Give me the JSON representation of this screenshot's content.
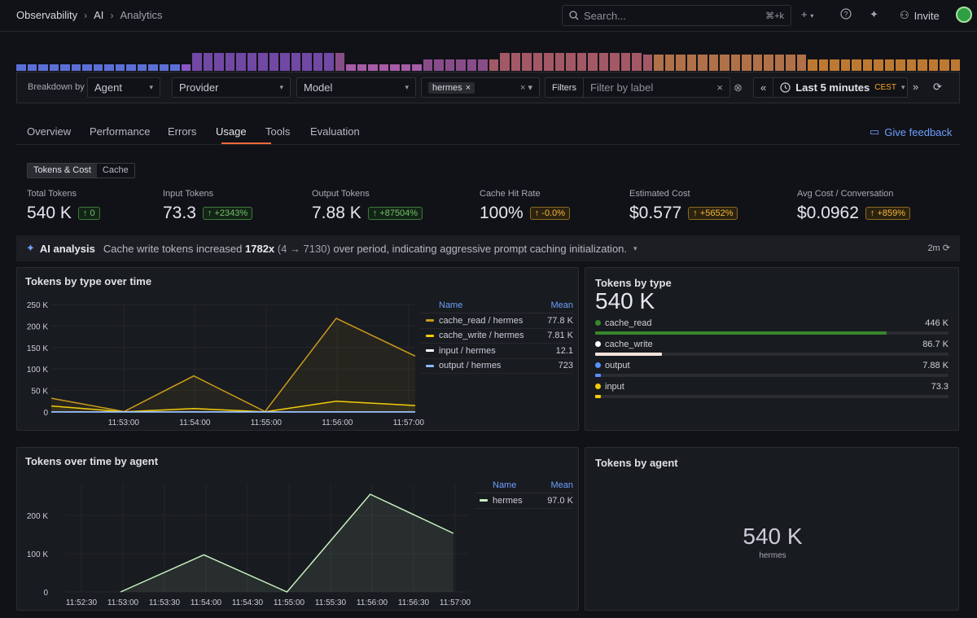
{
  "breadcrumbs": [
    "Observability",
    "AI",
    "Analytics"
  ],
  "search": {
    "placeholder": "Search...",
    "shortcut": "⌘+k"
  },
  "topbar": {
    "invite": "Invite"
  },
  "histogram": {
    "values": [
      3,
      3,
      3,
      3,
      3,
      3,
      3,
      3,
      3,
      3,
      3,
      3,
      3,
      3,
      3,
      3,
      8,
      8,
      8,
      8,
      8,
      8,
      8,
      8,
      8,
      8,
      8,
      8,
      8,
      8,
      3,
      3,
      3,
      3,
      3,
      3,
      3,
      5,
      5,
      5,
      5,
      5,
      5,
      5,
      8,
      8,
      8,
      8,
      8,
      8,
      8,
      8,
      8,
      8,
      8,
      8,
      8,
      7,
      7,
      7,
      7,
      7,
      7,
      7,
      7,
      7,
      7,
      7,
      7,
      7,
      7,
      7,
      5,
      5,
      5,
      5,
      5,
      5,
      5,
      5,
      5,
      5,
      5,
      5,
      5,
      5
    ],
    "colors": [
      "#5b6fd6",
      "#8a56c8",
      "#a65ca6",
      "#c86a7a",
      "#d88a56",
      "#e8943a"
    ]
  },
  "filters": {
    "breakdown_label": "Breakdown by",
    "breakdown_value": "Agent",
    "provider": "Provider",
    "model": "Model",
    "chip": "hermes",
    "filters_label": "Filters",
    "label_placeholder": "Filter by label",
    "time": "Last 5 minutes",
    "tz": "CEST"
  },
  "tabs": [
    "Overview",
    "Performance",
    "Errors",
    "Usage",
    "Tools",
    "Evaluation"
  ],
  "feedback": "Give feedback",
  "toggle": [
    "Tokens & Cost",
    "Cache"
  ],
  "stats": [
    {
      "label": "Total Tokens",
      "value": "540 K",
      "delta": "0",
      "tone": "g"
    },
    {
      "label": "Input Tokens",
      "value": "73.3",
      "delta": "+2343%",
      "tone": "g"
    },
    {
      "label": "Output Tokens",
      "value": "7.88 K",
      "delta": "+87504%",
      "tone": "g"
    },
    {
      "label": "Cache Hit Rate",
      "value": "100%",
      "delta": "-0.0%",
      "tone": "o"
    },
    {
      "label": "Estimated Cost",
      "value": "$0.577",
      "delta": "+5652%",
      "tone": "o"
    },
    {
      "label": "Avg Cost / Conversation",
      "value": "$0.0962",
      "delta": "+859%",
      "tone": "o"
    }
  ],
  "ai": {
    "title": "AI analysis",
    "text1": "Cache write tokens increased ",
    "bold": "1782x",
    "text2": " (4 → 7130)",
    "text3": " over period, indicating aggressive prompt caching initialization.",
    "age": "2m"
  },
  "panel1": {
    "title": "Tokens by type over time",
    "legend_name": "Name",
    "legend_mean": "Mean"
  },
  "panel2": {
    "title": "Tokens by type",
    "total": "540 K",
    "items": [
      {
        "name": "cache_read",
        "value": "446 K",
        "color": "#37872d",
        "dot": "#37872d",
        "frac": 0.826
      },
      {
        "name": "cache_write",
        "value": "86.7 K",
        "color": "#f4e2d8",
        "dot": "#ffffff",
        "frac": 0.19
      },
      {
        "name": "output",
        "value": "7.88 K",
        "color": "#5b8ff9",
        "dot": "#5b8ff9",
        "frac": 0.015
      },
      {
        "name": "input",
        "value": "73.3",
        "color": "#f2cc0c",
        "dot": "#f2cc0c",
        "frac": 0.002
      }
    ]
  },
  "panel3": {
    "title": "Tokens over time by agent",
    "legend_name": "Name",
    "legend_mean": "Mean"
  },
  "panel4": {
    "title": "Tokens by agent",
    "value": "540 K",
    "label": "hermes"
  },
  "chart_data": [
    {
      "type": "area",
      "title": "Tokens by type over time",
      "x": [
        "11:52:40",
        "11:53:00",
        "11:53:20",
        "11:53:40",
        "11:54:00",
        "11:54:20",
        "11:54:40",
        "11:55:00",
        "11:55:20",
        "11:55:40",
        "11:56:00",
        "11:56:20",
        "11:56:40",
        "11:57:00"
      ],
      "xticks": [
        "11:53:00",
        "11:54:00",
        "11:55:00",
        "11:56:00",
        "11:57:00"
      ],
      "yticks": [
        "0",
        "50 K",
        "100 K",
        "150 K",
        "200 K",
        "250 K"
      ],
      "ylim": [
        0,
        250000
      ],
      "series": [
        {
          "name": "cache_read / hermes",
          "mean": "77.8 K",
          "color": "#c99a1c",
          "points": [
            [
              0,
              32000
            ],
            [
              2.35,
              1000
            ],
            [
              4.6,
              84000
            ],
            [
              6.9,
              1000
            ],
            [
              9.2,
              218000
            ],
            [
              11.75,
              130000
            ]
          ]
        },
        {
          "name": "cache_write / hermes",
          "mean": "7.81 K",
          "color": "#f2cc0c",
          "points": [
            [
              0,
              14000
            ],
            [
              2.35,
              500
            ],
            [
              4.6,
              8000
            ],
            [
              6.9,
              500
            ],
            [
              9.2,
              25000
            ],
            [
              11.75,
              15000
            ]
          ]
        },
        {
          "name": "input / hermes",
          "mean": "12.1",
          "color": "#ffffff",
          "points": [
            [
              0,
              200
            ],
            [
              11.75,
              200
            ]
          ]
        },
        {
          "name": "output / hermes",
          "mean": "723",
          "color": "#8ab8ff",
          "points": [
            [
              0,
              0
            ],
            [
              11.75,
              0
            ]
          ]
        }
      ]
    },
    {
      "type": "area",
      "title": "Tokens over time by agent",
      "xticks": [
        "11:52:30",
        "11:53:00",
        "11:53:30",
        "11:54:00",
        "11:54:30",
        "11:55:00",
        "11:55:30",
        "11:56:00",
        "11:56:30",
        "11:57:00"
      ],
      "yticks": [
        "0",
        "100 K",
        "200 K"
      ],
      "ylim": [
        0,
        275000
      ],
      "series": [
        {
          "name": "hermes",
          "mean": "97.0 K",
          "color": "#c8f0c0",
          "points": [
            [
              1,
              0
            ],
            [
              3,
              95000
            ],
            [
              5,
              0
            ],
            [
              7,
              250000
            ],
            [
              9,
              150000
            ]
          ]
        }
      ]
    }
  ]
}
